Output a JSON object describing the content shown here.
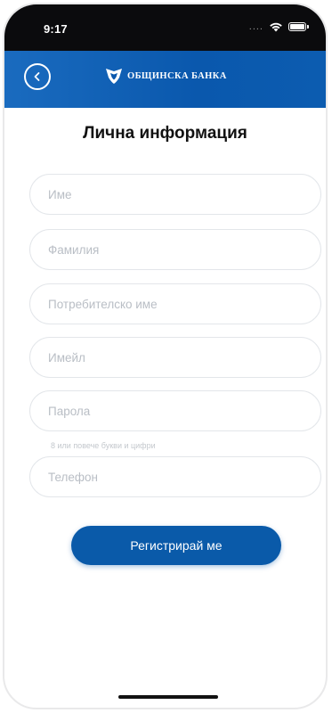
{
  "status_bar": {
    "time": "9:17",
    "dots": "...."
  },
  "header": {
    "brand": "ОБЩИНСКА БАНКА"
  },
  "page": {
    "title": "Лична информация"
  },
  "form": {
    "first_name_placeholder": "Име",
    "last_name_placeholder": "Фамилия",
    "username_placeholder": "Потребителско име",
    "email_placeholder": "Имейл",
    "password_placeholder": "Парола",
    "password_hint": "8 или повече букви и цифри",
    "phone_placeholder": "Телефон"
  },
  "actions": {
    "register_label": "Регистрирай ме"
  },
  "colors": {
    "brand_blue": "#0a5aa9",
    "status_bar": "#0b0b0d"
  }
}
